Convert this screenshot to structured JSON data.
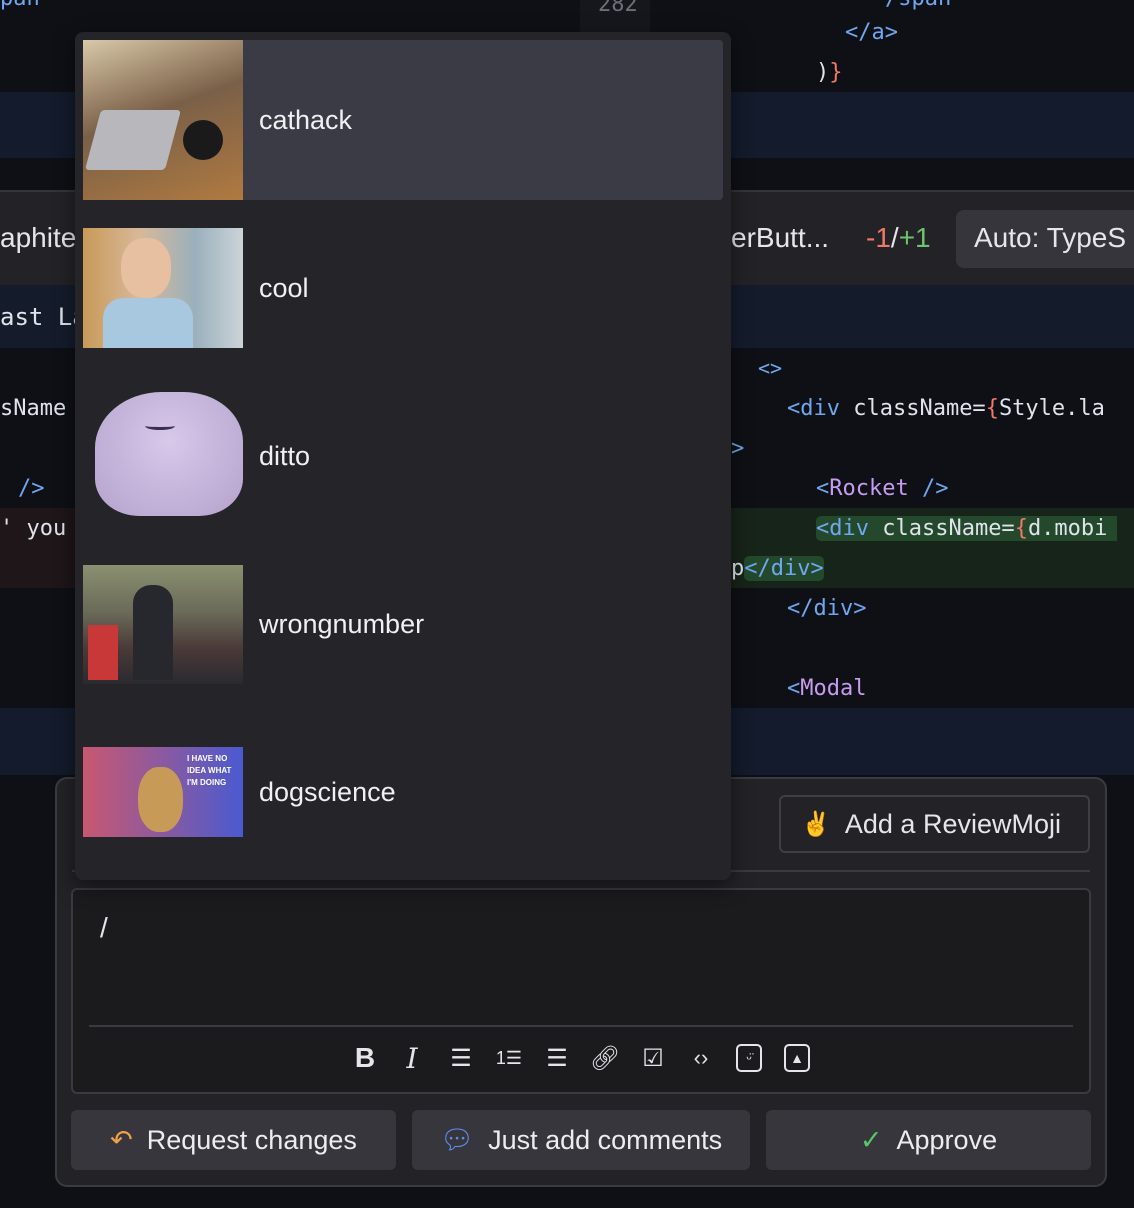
{
  "code_background": {
    "top_right": {
      "line_close_span": "/span",
      "line_close_a": "</a>",
      "line_paren": ")",
      "line_brace": "}"
    },
    "gutter_line_number": "282",
    "file_header": {
      "left_title": "aphite",
      "right_title": "erButt...",
      "deletions": "-1",
      "slash": "/",
      "additions": "+1",
      "auto_button": "Auto: TypeS"
    },
    "left_snippets": {
      "last_label": "ast La",
      "classname": "sName",
      "self_close": "/>",
      "you": "' you",
      "top_span": "pan"
    },
    "right_code": {
      "fragment": "<>",
      "div_open_tag": "<div",
      "div_attr": " className=",
      "div_brace": "{",
      "div_value": "Style.la",
      "arrow": ">",
      "rocket": "Rocket",
      "rocket_open": "<",
      "rocket_close": " />",
      "div2_tag": "<div",
      "div2_attr": " className=",
      "div2_brace": "{",
      "div2_value": "d.mobi",
      "p_text": "p",
      "div_close_added": "</div>",
      "div_close": "</div>",
      "modal_open": "<",
      "modal": "Modal"
    }
  },
  "gif_dropdown": {
    "items": [
      {
        "label": "cathack",
        "selected": true
      },
      {
        "label": "cool",
        "selected": false
      },
      {
        "label": "ditto",
        "selected": false
      },
      {
        "label": "wrongnumber",
        "selected": false
      },
      {
        "label": "dogscience",
        "selected": false
      }
    ],
    "dogscience_caption": "I HAVE NO IDEA WHAT I'M DOING"
  },
  "review_panel": {
    "add_reviewmoji": "Add a ReviewMoji",
    "comment_value": "/",
    "toolbar": [
      "bold-icon",
      "italic-icon",
      "bullet-list-icon",
      "numbered-list-icon",
      "quote-icon",
      "link-icon",
      "checkbox-icon",
      "code-icon",
      "emoji-icon",
      "image-icon"
    ],
    "request_changes": "Request changes",
    "just_add_comments": "Just add comments",
    "approve": "Approve"
  },
  "colors": {
    "request_changes_icon": "#f0a04a",
    "comment_icon": "#5b8ef0",
    "approve_icon": "#5cc46e",
    "deletions": "#f07866",
    "additions": "#6cc46e"
  }
}
